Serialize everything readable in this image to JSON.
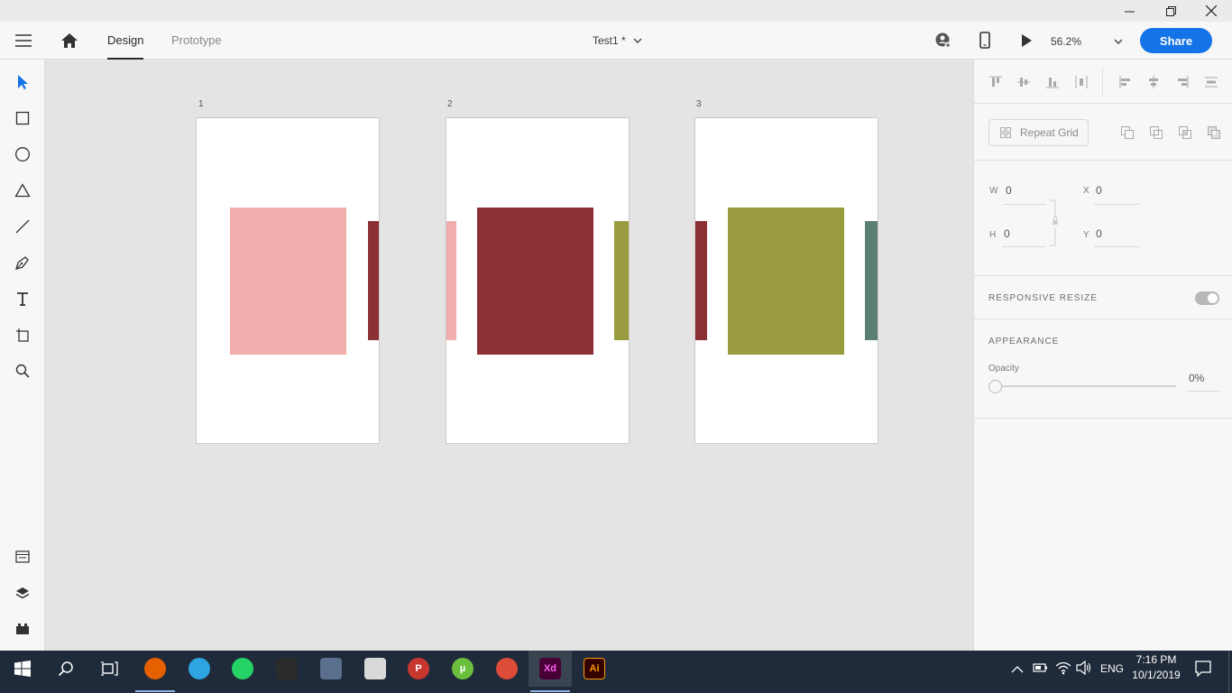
{
  "app": {
    "tabs": [
      {
        "label": "Design",
        "active": true
      },
      {
        "label": "Prototype",
        "active": false
      }
    ],
    "document_title": "Test1 *",
    "zoom": "56.2%",
    "share_label": "Share",
    "accent_color": "#1473e6"
  },
  "tools": [
    "select-icon",
    "rectangle-icon",
    "ellipse-icon",
    "polygon-icon",
    "line-icon",
    "pen-icon",
    "text-icon",
    "artboard-icon",
    "zoom-icon"
  ],
  "bottom_tools": [
    "assets-icon",
    "layers-icon",
    "plugins-icon"
  ],
  "artboards": [
    {
      "label": "1",
      "center_color": "#f2adad",
      "left_peek_color": null,
      "right_peek_color": "#8b3033"
    },
    {
      "label": "2",
      "center_color": "#8b3033",
      "left_peek_color": "#f2adad",
      "right_peek_color": "#989b3e"
    },
    {
      "label": "3",
      "center_color": "#989b3e",
      "left_peek_color": "#8b3033",
      "right_peek_color": "#5b7f72"
    }
  ],
  "properties": {
    "repeat_grid_label": "Repeat Grid",
    "w_label": "W",
    "w_value": "0",
    "h_label": "H",
    "h_value": "0",
    "x_label": "X",
    "x_value": "0",
    "y_label": "Y",
    "y_value": "0",
    "responsive_resize_label": "RESPONSIVE RESIZE",
    "responsive_resize_on": true,
    "appearance_label": "APPEARANCE",
    "opacity_label": "Opacity",
    "opacity_value": "0%"
  },
  "taskbar": {
    "apps": [
      {
        "name": "firefox",
        "color": "#e66000",
        "text": ""
      },
      {
        "name": "telegram",
        "color": "#2ca5e0",
        "text": ""
      },
      {
        "name": "whatsapp",
        "color": "#25d366",
        "text": ""
      },
      {
        "name": "calculator",
        "color": "#2b2b2b",
        "text": ""
      },
      {
        "name": "network-tool",
        "color": "#5a6f8e",
        "text": ""
      },
      {
        "name": "red-app",
        "color": "#d9d9d9",
        "text": ""
      },
      {
        "name": "p-app",
        "color": "#c8372d",
        "text": "P"
      },
      {
        "name": "utorrent",
        "color": "#6bbf3c",
        "text": "µ"
      },
      {
        "name": "chrome",
        "color": "#dd4b39",
        "text": ""
      },
      {
        "name": "adobe-xd",
        "color": "#470137",
        "text": "Xd"
      },
      {
        "name": "adobe-illustrator",
        "color": "#330000",
        "text": "Ai"
      }
    ],
    "language": "ENG",
    "time": "7:16 PM",
    "date": "10/1/2019"
  }
}
